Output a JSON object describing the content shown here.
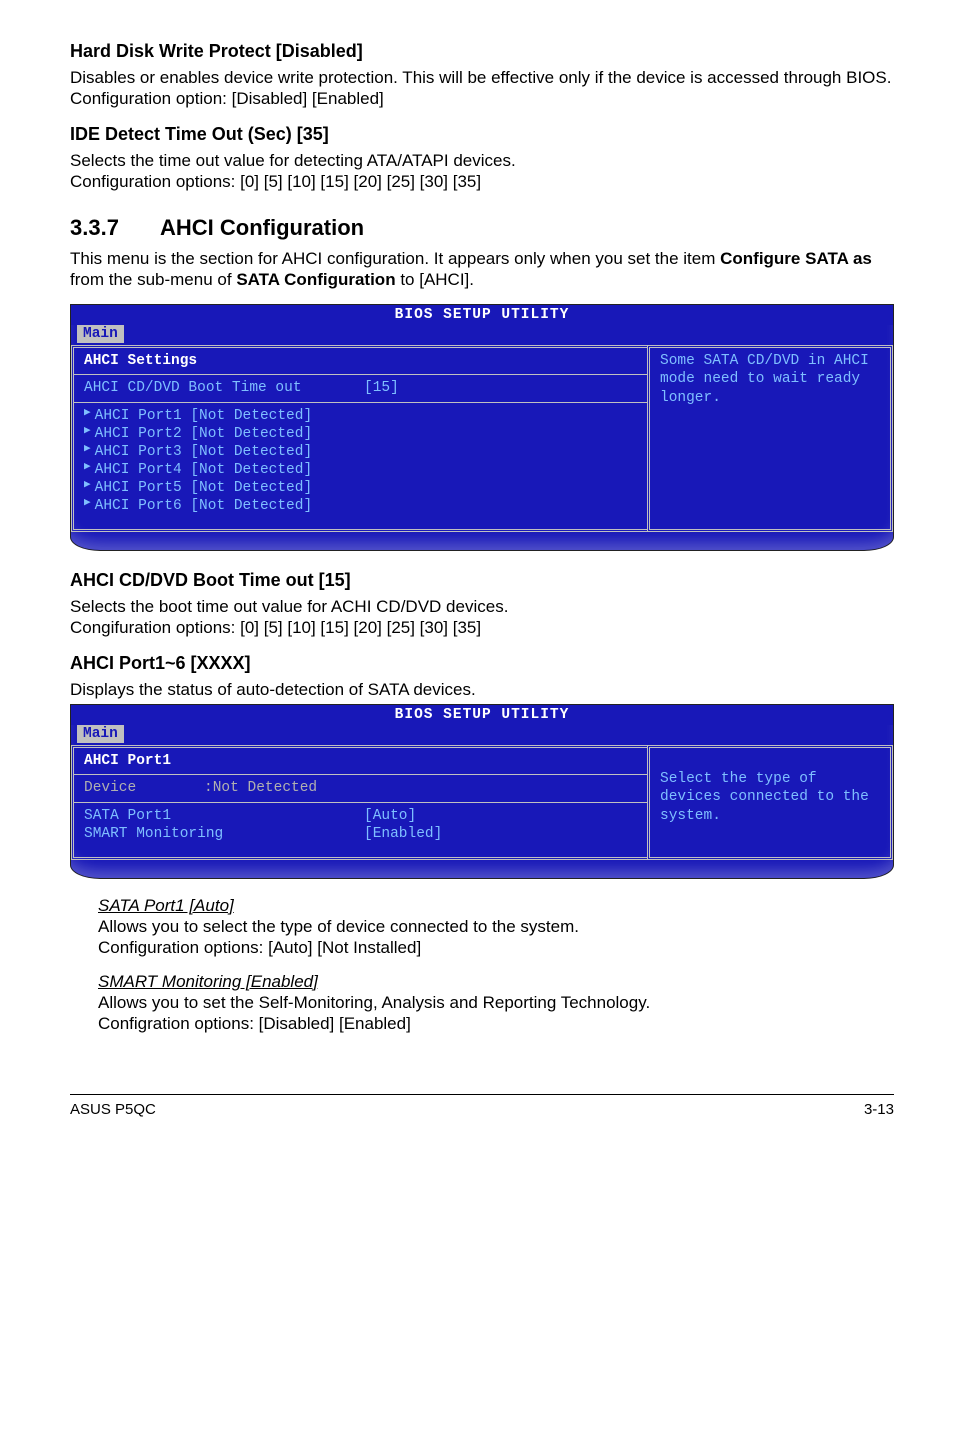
{
  "sections": {
    "hdwp": {
      "title": "Hard Disk Write Protect [Disabled]",
      "p1": "Disables or enables device write protection. This will be effective only if the device is accessed through BIOS.",
      "p2": "Configuration option: [Disabled] [Enabled]"
    },
    "ide": {
      "title": "IDE Detect Time Out (Sec) [35]",
      "p1": "Selects the time out value for detecting ATA/ATAPI devices.",
      "p2": "Configuration options: [0] [5] [10] [15] [20] [25] [30] [35]"
    },
    "ahci": {
      "num": "3.3.7",
      "title": "AHCI Configuration",
      "p1a": "This menu is the section for AHCI configuration. It appears only when you set the item ",
      "p1b": "Configure SATA as",
      "p1c": " from the sub-menu of ",
      "p1d": "SATA Configuration",
      "p1e": " to [AHCI]."
    },
    "boot": {
      "title": "AHCI CD/DVD Boot Time out [15]",
      "p1": "Selects the boot time out value for ACHI CD/DVD devices.",
      "p2": "Congifuration options: [0] [5] [10] [15] [20] [25] [30] [35]"
    },
    "ports": {
      "title": "AHCI Port1~6 [XXXX]",
      "p1": "Displays the status of auto-detection of SATA devices."
    },
    "sub": {
      "sata": {
        "title": "SATA Port1 [Auto]",
        "p1": "Allows you to select the type of device connected to the system.",
        "p2": "Configuration options: [Auto] [Not Installed]"
      },
      "smart": {
        "title": "SMART Monitoring [Enabled]",
        "p1": "Allows you to set the Self-Monitoring, Analysis and Reporting Technology.",
        "p2": "Configration options: [Disabled] [Enabled]"
      }
    }
  },
  "bios1": {
    "title": "BIOS SETUP UTILITY",
    "tab": "Main",
    "header": "AHCI Settings",
    "bootLbl": "AHCI CD/DVD Boot Time out",
    "bootVal": "[15]",
    "ports": [
      "AHCI Port1 [Not Detected]",
      "AHCI Port2 [Not Detected]",
      "AHCI Port3 [Not Detected]",
      "AHCI Port4 [Not Detected]",
      "AHCI Port5 [Not Detected]",
      "AHCI Port6 [Not Detected]"
    ],
    "help": "Some SATA CD/DVD in AHCI mode need to wait ready longer."
  },
  "bios2": {
    "title": "BIOS SETUP UTILITY",
    "tab": "Main",
    "header": "AHCI Port1",
    "devLbl": "Device",
    "devVal": ":Not Detected",
    "r1lbl": "SATA Port1",
    "r1val": "[Auto]",
    "r2lbl": "SMART Monitoring",
    "r2val": "[Enabled]",
    "help": "Select the type of devices connected to the system."
  },
  "footer": {
    "left": "ASUS P5QC",
    "right": "3-13"
  }
}
